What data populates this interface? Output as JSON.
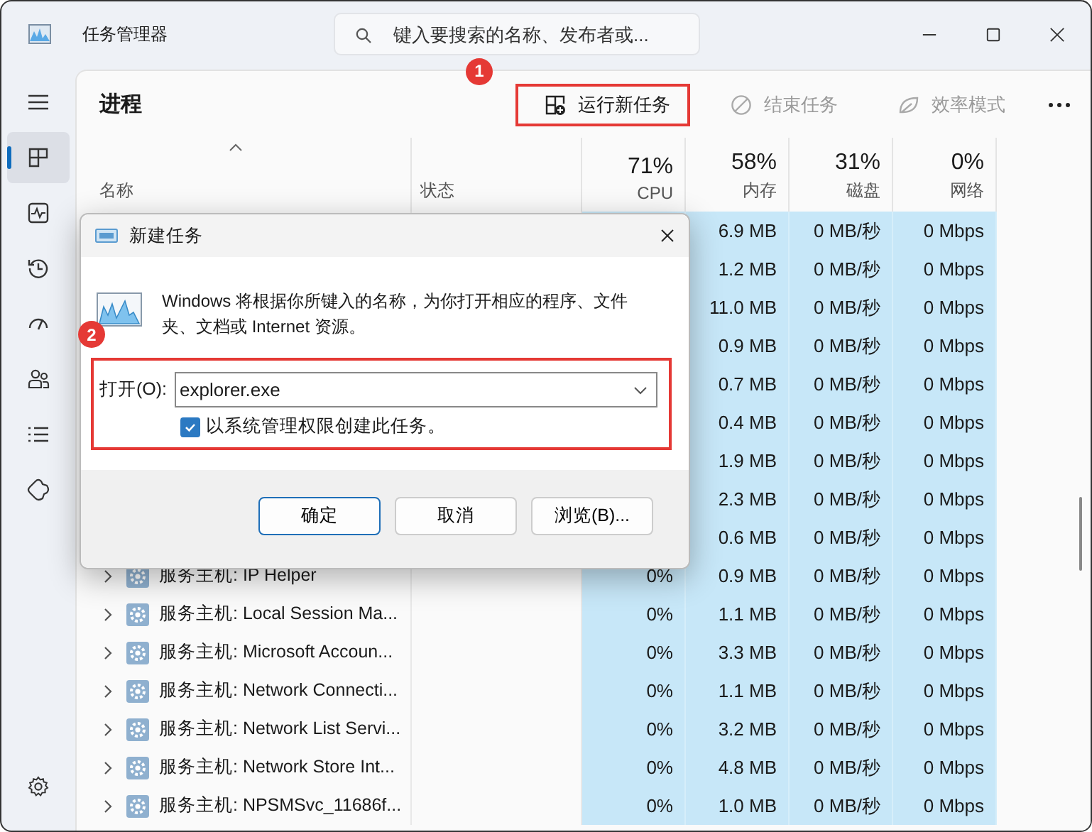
{
  "window": {
    "title": "任务管理器"
  },
  "search": {
    "placeholder": "键入要搜索的名称、发布者或..."
  },
  "sidebar": {
    "items": [
      {
        "kind": "menu",
        "selected": false
      },
      {
        "kind": "processes",
        "selected": true
      },
      {
        "kind": "performance",
        "selected": false
      },
      {
        "kind": "history",
        "selected": false
      },
      {
        "kind": "startup",
        "selected": false
      },
      {
        "kind": "users",
        "selected": false
      },
      {
        "kind": "details",
        "selected": false
      },
      {
        "kind": "services",
        "selected": false
      },
      {
        "kind": "settings",
        "selected": false
      }
    ]
  },
  "page_title": "进程",
  "toolbar": [
    {
      "kind": "run",
      "label": "运行新任务",
      "disabled": false,
      "highlighted": true,
      "callout": "1"
    },
    {
      "kind": "end",
      "label": "结束任务",
      "disabled": true,
      "highlighted": false
    },
    {
      "kind": "eco",
      "label": "效率模式",
      "disabled": true,
      "highlighted": false
    }
  ],
  "table": {
    "columns": [
      {
        "label": "名称"
      },
      {
        "label": "状态"
      },
      {
        "usage": "71%",
        "label": "CPU"
      },
      {
        "usage": "58%",
        "label": "内存"
      },
      {
        "usage": "31%",
        "label": "磁盘"
      },
      {
        "usage": "0%",
        "label": "网络"
      }
    ],
    "rows": [
      {
        "memory": "6.9 MB",
        "disk": "0 MB/秒",
        "network": "0 Mbps"
      },
      {
        "memory": "1.2 MB",
        "disk": "0 MB/秒",
        "network": "0 Mbps"
      },
      {
        "memory": "11.0 MB",
        "disk": "0 MB/秒",
        "network": "0 Mbps"
      },
      {
        "memory": "0.9 MB",
        "disk": "0 MB/秒",
        "network": "0 Mbps"
      },
      {
        "memory": "0.7 MB",
        "disk": "0 MB/秒",
        "network": "0 Mbps"
      },
      {
        "memory": "0.4 MB",
        "disk": "0 MB/秒",
        "network": "0 Mbps"
      },
      {
        "memory": "1.9 MB",
        "disk": "0 MB/秒",
        "network": "0 Mbps"
      },
      {
        "memory": "2.3 MB",
        "disk": "0 MB/秒",
        "network": "0 Mbps"
      },
      {
        "memory": "0.6 MB",
        "disk": "0 MB/秒",
        "network": "0 Mbps"
      },
      {
        "name": "服务主机: IP Helper",
        "cpu": "0%",
        "memory": "0.9 MB",
        "disk": "0 MB/秒",
        "network": "0 Mbps"
      },
      {
        "name": "服务主机: Local Session Ma...",
        "cpu": "0%",
        "memory": "1.1 MB",
        "disk": "0 MB/秒",
        "network": "0 Mbps"
      },
      {
        "name": "服务主机: Microsoft Accoun...",
        "cpu": "0%",
        "memory": "3.3 MB",
        "disk": "0 MB/秒",
        "network": "0 Mbps"
      },
      {
        "name": "服务主机: Network Connecti...",
        "cpu": "0%",
        "memory": "1.1 MB",
        "disk": "0 MB/秒",
        "network": "0 Mbps"
      },
      {
        "name": "服务主机: Network List Servi...",
        "cpu": "0%",
        "memory": "3.2 MB",
        "disk": "0 MB/秒",
        "network": "0 Mbps"
      },
      {
        "name": "服务主机: Network Store Int...",
        "cpu": "0%",
        "memory": "4.8 MB",
        "disk": "0 MB/秒",
        "network": "0 Mbps"
      },
      {
        "name": "服务主机: NPSMSvc_11686f...",
        "cpu": "0%",
        "memory": "1.0 MB",
        "disk": "0 MB/秒",
        "network": "0 Mbps"
      }
    ]
  },
  "dialog": {
    "title": "新建任务",
    "message": "Windows 将根据你所键入的名称，为你打开相应的程序、文件夹、文档或 Internet 资源。",
    "open_label": "打开(O):",
    "open_value": "explorer.exe",
    "admin_label": "以系统管理权限创建此任务。",
    "admin_checked": true,
    "highlighted": true,
    "callout": "2",
    "buttons": [
      {
        "label": "确定",
        "default": true
      },
      {
        "label": "取消",
        "default": false
      },
      {
        "label": "浏览(B)...",
        "default": false
      }
    ]
  }
}
